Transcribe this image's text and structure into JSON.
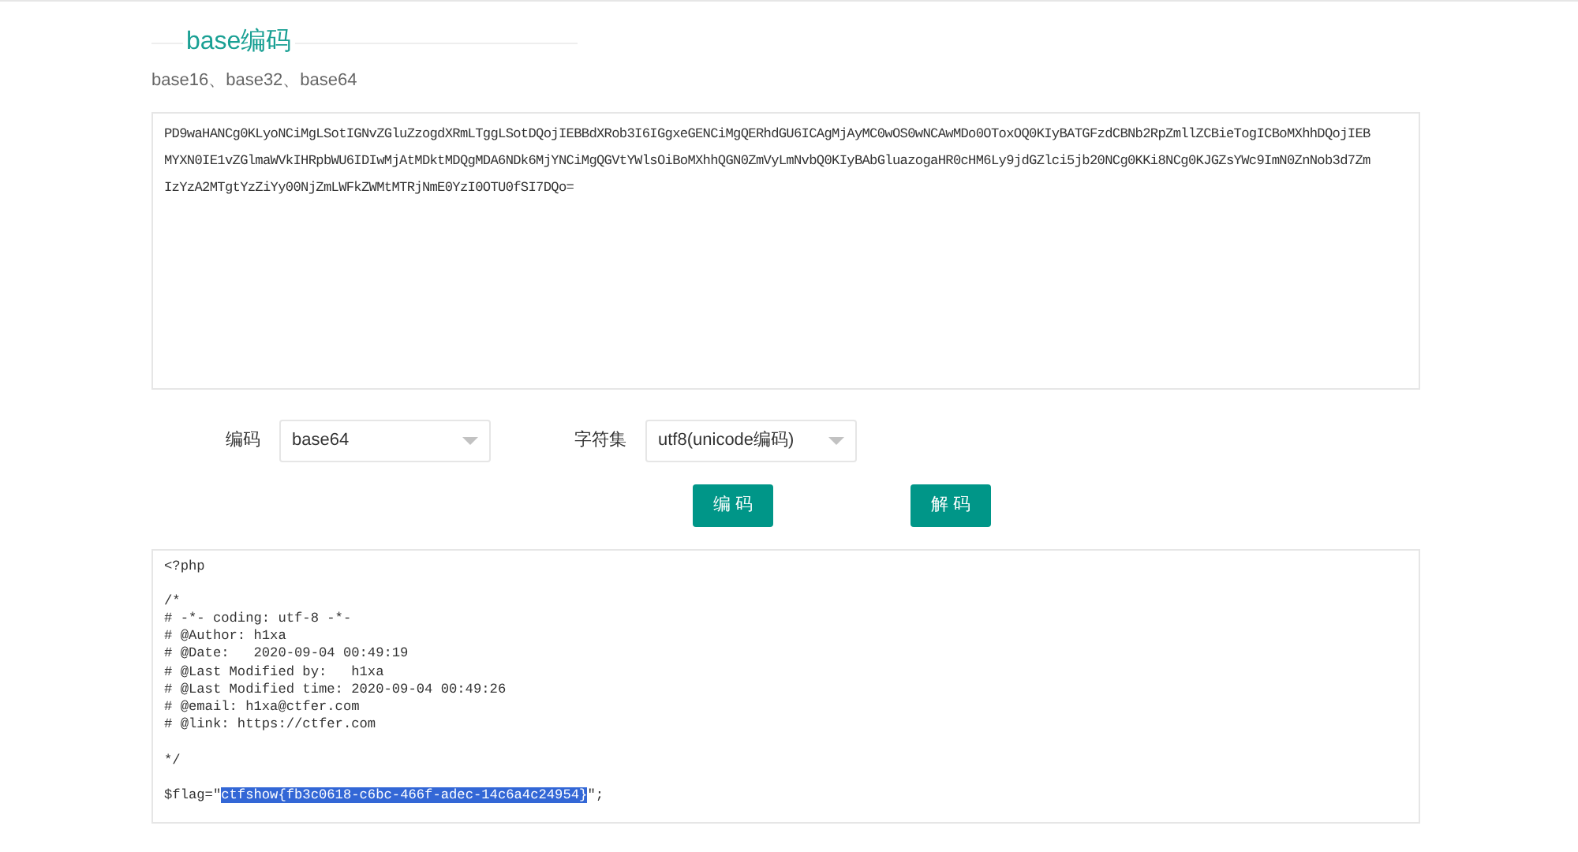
{
  "section": {
    "title": "base编码",
    "subtitle": "base16、base32、base64"
  },
  "input": {
    "lines": [
      "PD9waHANCg0KLyoNCiMgLSotIGNvZGluZzogdXRmLTggLSotDQojIEBBdXRob3I6IGgxeGENCiMgQERhdGU6ICAgMjAyMC0wOS0wNCAwMDo0OToxOQ0KIyBATGFzdCBNb2RpZmllZCBieTogICBoMXhhDQojIEB",
      "MYXN0IE1vZGlmaWVkIHRpbWU6IDIwMjAtMDktMDQgMDA6NDk6MjYNCiMgQGVtYWlsOiBoMXhhQGN0ZmVyLmNvbQ0KIyBAbGluazogaHR0cHM6Ly9jdGZlci5jb20NCg0KKi8NCg0KJGZsYWc9ImN0ZnNob3d7Zm",
      "IzYzA2MTgtYzZiYy00NjZmLWFkZWMtMTRjNmE0YzI0OTU0fSI7DQo="
    ]
  },
  "options": [
    {
      "label": "编码",
      "value": "base64"
    },
    {
      "label": "字符集",
      "value": "utf8(unicode编码)"
    }
  ],
  "buttons": [
    "编 码",
    "解 码"
  ],
  "output": {
    "lines": [
      {
        "text": "<?php",
        "space_before": false
      },
      {
        "text": "/*",
        "space_before": true
      },
      {
        "text": "# -*- coding: utf-8 -*-"
      },
      {
        "text": "# @Author: h1xa"
      },
      {
        "text": "# @Date:   2020-09-04 00:49:19"
      },
      {
        "text": "# @Last Modified by:   h1xa"
      },
      {
        "text": "# @Last Modified time: 2020-09-04 00:49:26"
      },
      {
        "text": "# @email: h1xa@ctfer.com"
      },
      {
        "text": "# @link: https://ctfer.com"
      },
      {
        "text": "*/",
        "space_before": true
      },
      {
        "space_before": true,
        "text": "$flag=\"",
        "selected_text": "ctfshow{fb3c0618-c6bc-466f-adec-14c6a4c24954}",
        "after": "\";"
      }
    ]
  }
}
